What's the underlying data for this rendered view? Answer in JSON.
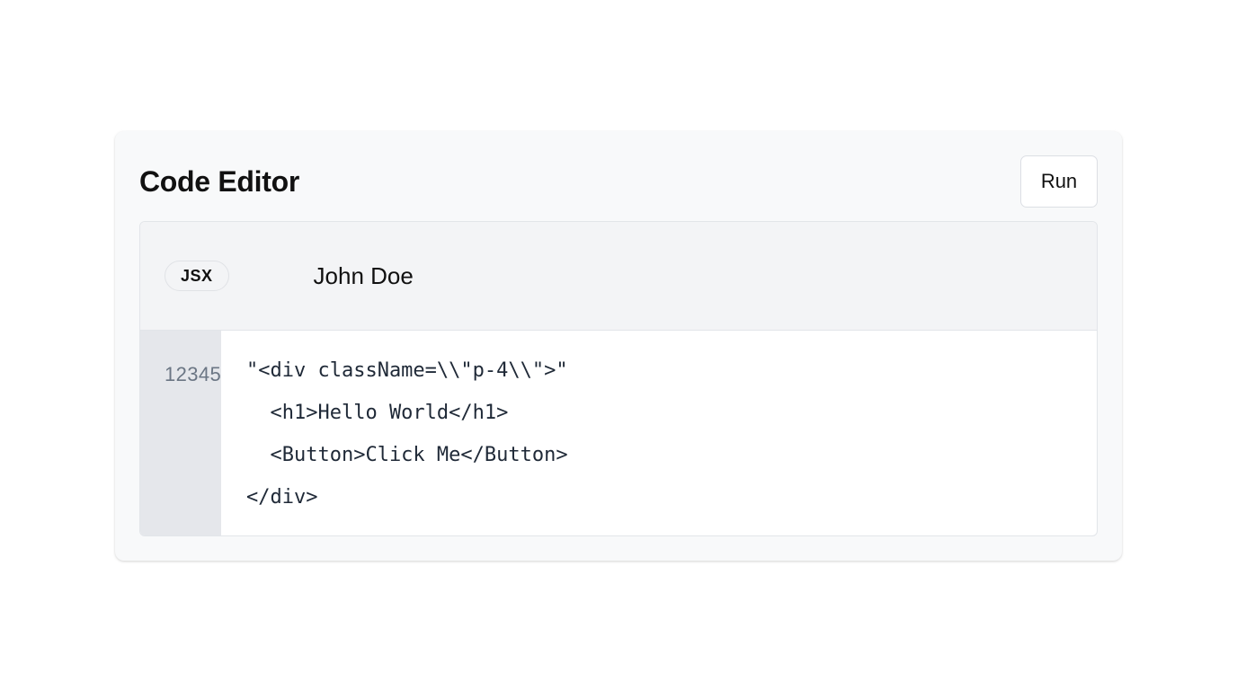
{
  "header": {
    "title": "Code Editor",
    "run_label": "Run"
  },
  "editor": {
    "language": "JSX",
    "author": "John Doe",
    "line_numbers": "12345",
    "lines": [
      "\"<div className=\\\\\"p-4\\\\\">\"",
      "  <h1>Hello World</h1>",
      "  <Button>Click Me</Button>",
      "</div>"
    ]
  },
  "colors": {
    "card_background": "#f8f9fa",
    "toolbar_background": "#f3f4f6",
    "gutter_background": "#e5e7eb",
    "gutter_text": "#6b7684"
  }
}
